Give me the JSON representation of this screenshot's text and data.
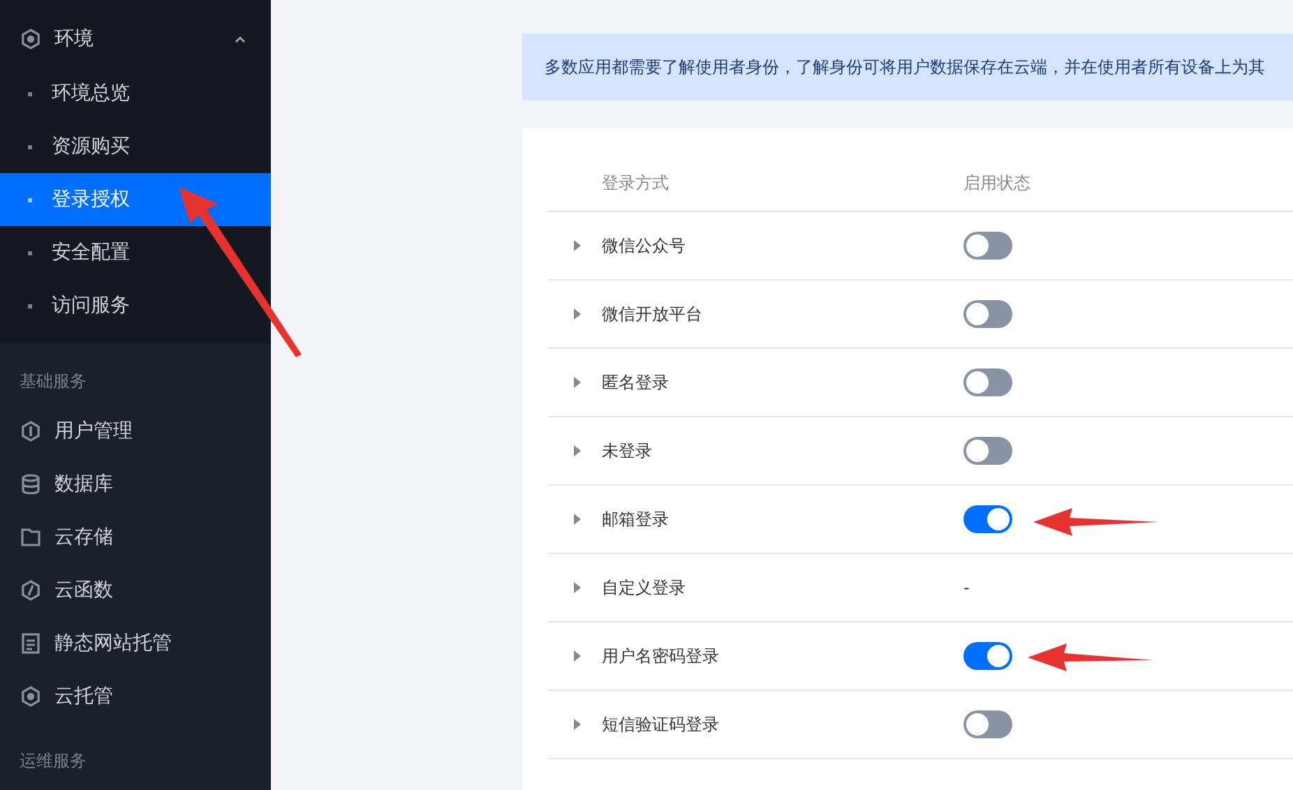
{
  "sidebar": {
    "env_group": {
      "label": "环境",
      "expanded": true,
      "children": [
        {
          "label": "环境总览",
          "selected": false
        },
        {
          "label": "资源购买",
          "selected": false
        },
        {
          "label": "登录授权",
          "selected": true
        },
        {
          "label": "安全配置",
          "selected": false
        },
        {
          "label": "访问服务",
          "selected": false
        }
      ]
    },
    "sections": [
      {
        "title": "基础服务",
        "items": [
          {
            "label": "用户管理"
          },
          {
            "label": "数据库"
          },
          {
            "label": "云存储"
          },
          {
            "label": "云函数"
          },
          {
            "label": "静态网站托管"
          },
          {
            "label": "云托管"
          }
        ]
      },
      {
        "title": "运维服务"
      }
    ]
  },
  "banner": "多数应用都需要了解使用者身份，了解身份可将用户数据保存在云端，并在使用者所有设备上为其",
  "table": {
    "columns": [
      "登录方式",
      "启用状态"
    ],
    "rows": [
      {
        "name": "微信公众号",
        "kind": "toggle",
        "on": false
      },
      {
        "name": "微信开放平台",
        "kind": "toggle",
        "on": false
      },
      {
        "name": "匿名登录",
        "kind": "toggle",
        "on": false
      },
      {
        "name": "未登录",
        "kind": "toggle",
        "on": false
      },
      {
        "name": "邮箱登录",
        "kind": "toggle",
        "on": true
      },
      {
        "name": "自定义登录",
        "kind": "text",
        "value": "-"
      },
      {
        "name": "用户名密码登录",
        "kind": "toggle",
        "on": true
      },
      {
        "name": "短信验证码登录",
        "kind": "toggle",
        "on": false
      }
    ]
  }
}
